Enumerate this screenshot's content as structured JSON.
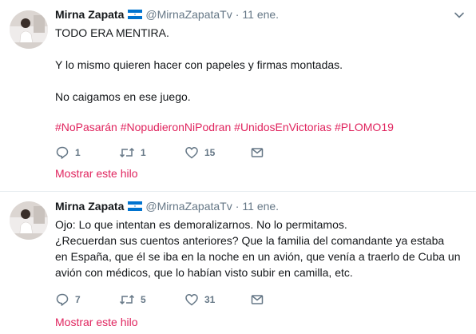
{
  "colors": {
    "accent": "#e0245e",
    "text": "#14171a",
    "muted": "#657786",
    "divider": "#e6ecf0"
  },
  "tweets": [
    {
      "author": {
        "name": "Mirna Zapata",
        "handle": "@MirnaZapataTv"
      },
      "separator": "·",
      "timestamp": "11 ene.",
      "text": "TODO ERA MENTIRA.\n\nY lo mismo quieren hacer con papeles y firmas montadas.\n\nNo caigamos en ese juego.",
      "hashtags": [
        "#NoPasarán",
        "#NopudieronNiPodran",
        "#UnidosEnVictorias",
        "#PLOMO19"
      ],
      "counts": {
        "replies": "1",
        "retweets": "1",
        "likes": "15"
      },
      "show_thread": "Mostrar este hilo"
    },
    {
      "author": {
        "name": "Mirna Zapata",
        "handle": "@MirnaZapataTv"
      },
      "separator": "·",
      "timestamp": "11 ene.",
      "text": "Ojo: Lo que intentan es demoralizarnos. No lo permitamos.\n¿Recuerdan sus cuentos anteriores? Que la familia del comandante ya estaba\nen España, que él se iba en la noche en un avión, que venía a traerlo de Cuba un\navión con médicos, que lo habían visto subir en camilla, etc.",
      "counts": {
        "replies": "7",
        "retweets": "5",
        "likes": "31"
      },
      "show_thread": "Mostrar este hilo"
    }
  ]
}
